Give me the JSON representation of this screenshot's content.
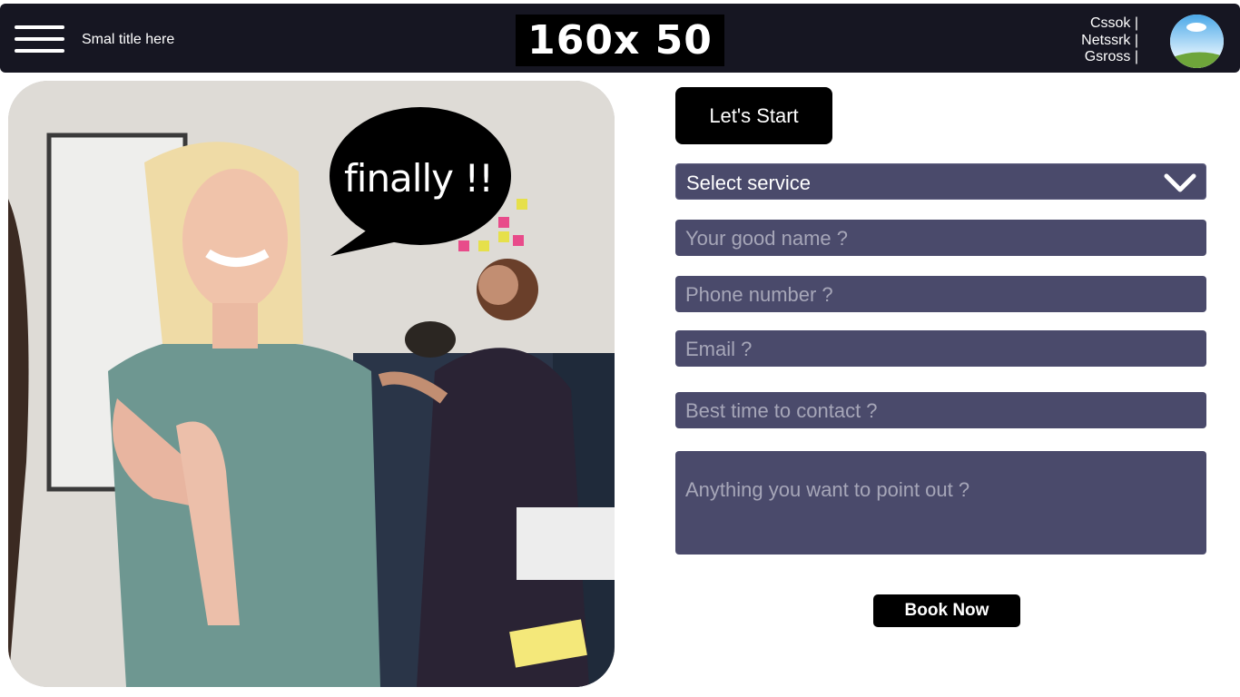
{
  "header": {
    "title": "Smal title  here",
    "logo_text": "160x 50",
    "links": [
      "Cssok |",
      "Netssrk |",
      "Gsross |"
    ]
  },
  "hero": {
    "bubble_text": "finally !!"
  },
  "form": {
    "start_label": "Let's Start",
    "service_select": "Select service",
    "name_placeholder": "Your good name  ?",
    "phone_placeholder": "Phone number ?",
    "email_placeholder": "Email ?",
    "time_placeholder": "Best time to contact  ?",
    "notes_placeholder": "Anything you want to point out ?",
    "submit_label": "Book Now"
  },
  "colors": {
    "header_bg": "#161622",
    "field_bg": "#4a4a6b",
    "button_bg": "#000000"
  }
}
